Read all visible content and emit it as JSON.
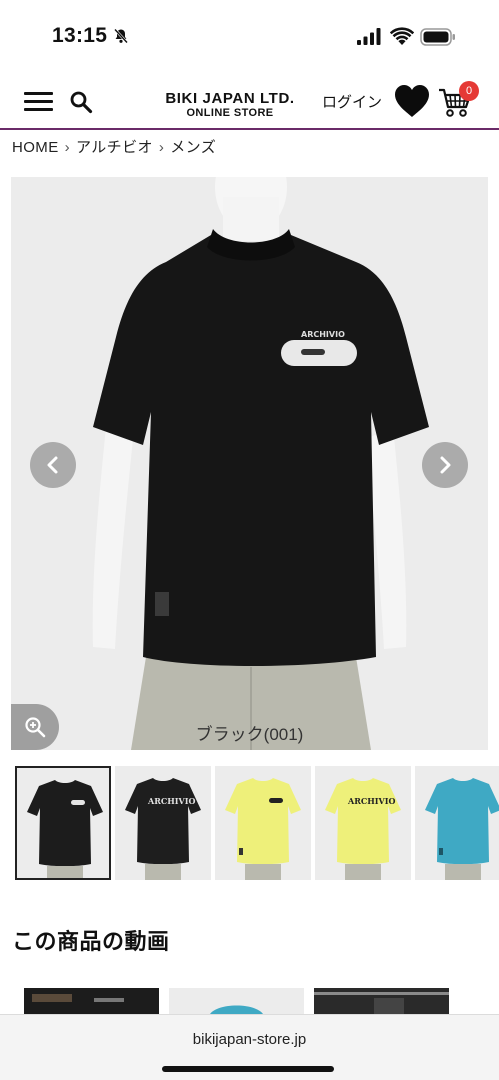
{
  "status_bar": {
    "time": "13:15",
    "icons": [
      "bell-slash-icon",
      "signal-icon",
      "wifi-icon",
      "battery-icon"
    ]
  },
  "header": {
    "logo_main": "BIKI JAPAN LTD.",
    "logo_sub": "ONLINE STORE",
    "login_label": "ログイン",
    "cart_count": "0",
    "accent_color": "#6a2a68",
    "badge_color": "#e53935"
  },
  "breadcrumb": {
    "items": [
      "HOME",
      "アルチビオ",
      "メンズ"
    ],
    "separator": "›"
  },
  "product": {
    "main_image_alt": "ARCHIVIO",
    "color_caption": "ブラック(001)",
    "shirt_logo": "ARCHIVIO",
    "thumbnails": [
      {
        "color": "#1c1c1c",
        "view": "front",
        "print": ""
      },
      {
        "color": "#1e1e1e",
        "view": "back",
        "print": "ARCHIVIO"
      },
      {
        "color": "#eef07a",
        "view": "front",
        "print": ""
      },
      {
        "color": "#eef07a",
        "view": "back",
        "print": "ARCHIVIO"
      },
      {
        "color": "#3fa9c4",
        "view": "front",
        "print": ""
      }
    ]
  },
  "video_section": {
    "title": "この商品の動画"
  },
  "browser": {
    "url": "bikijapan-store.jp"
  }
}
